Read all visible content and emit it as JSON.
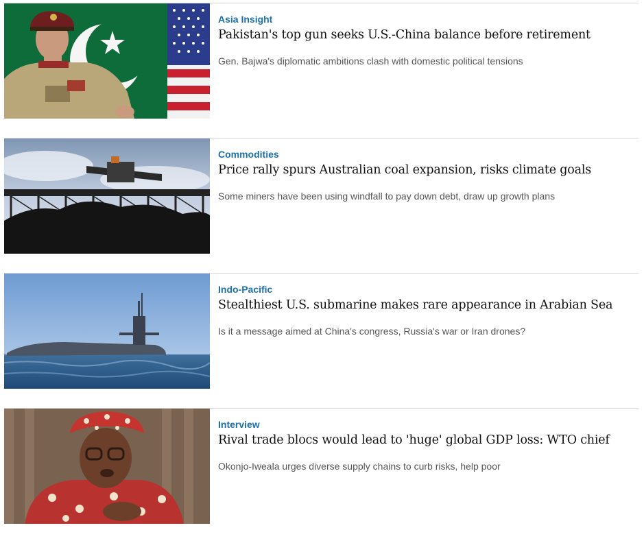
{
  "articles": [
    {
      "kicker": "Asia Insight",
      "headline": "Pakistan's top gun seeks U.S.-China balance before retirement",
      "summary": "Gen. Bajwa's diplomatic ambitions clash with domestic political tensions",
      "image": "general-with-pakistan-and-us-flags"
    },
    {
      "kicker": "Commodities",
      "headline": "Price rally spurs Australian coal expansion, risks climate goals",
      "summary": "Some miners have been using windfall to pay down debt, draw up growth plans",
      "image": "coal-stockpile-and-loader"
    },
    {
      "kicker": "Indo-Pacific",
      "headline": "Stealthiest U.S. submarine makes rare appearance in Arabian Sea",
      "summary": "Is it a message aimed at China's congress, Russia's war or Iran drones?",
      "image": "submarine-at-sea"
    },
    {
      "kicker": "Interview",
      "headline": "Rival trade blocs would lead to 'huge' global GDP loss: WTO chief",
      "summary": "Okonjo-Iweala urges diverse supply chains to curb risks, help poor",
      "image": "woman-speaking-in-headwrap"
    }
  ]
}
